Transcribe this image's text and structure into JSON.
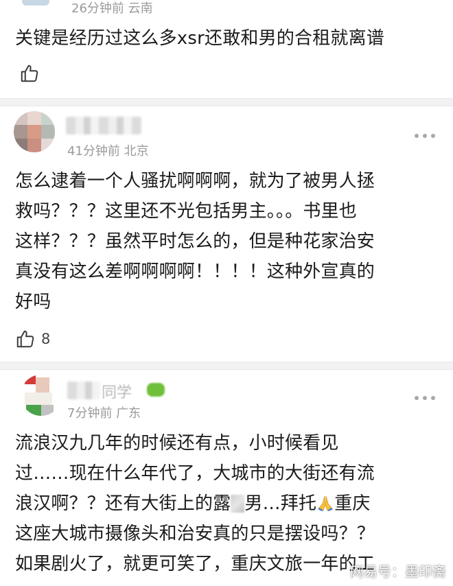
{
  "comments": [
    {
      "meta": "26分钟前 云南",
      "text_lines": [
        "关键是经历过这么多xsr还敢和男的合租就离谱"
      ],
      "likes": ""
    },
    {
      "meta": "41分钟前 北京",
      "text_lines": [
        "怎么逮着一个人骚扰啊啊啊，就为了被男人拯",
        "救吗？？？这里还不光包括男主。。。书里也",
        "这样？？？虽然平时怎么的，但是种花家治安",
        "真没有这么差啊啊啊啊！！！！这种外宣真的",
        "好吗"
      ],
      "likes": "8"
    },
    {
      "name_partial": "同学",
      "meta": "7分钟前 广东",
      "text_lines": [
        "流浪汉九几年的时候还有点，小时候看见",
        "过……现在什么年代了，大城市的大街还有流",
        "浪汉啊？？还有大街上的露",
        "男…拜托",
        "重庆",
        "这座大城市摄像头和治安真的只是摆设吗？？",
        "如果剧火了，就更可笑了，重庆文旅一年的工"
      ]
    }
  ],
  "watermark": "网易号：墨印斋",
  "icons": {
    "like": "thumbs-up-icon",
    "more": "more-dots-icon",
    "pray": "pray-emoji-icon"
  },
  "colors": {
    "meta": "#9a9a9a",
    "text": "#1b1b1b",
    "divider": "#f2f2f2"
  }
}
